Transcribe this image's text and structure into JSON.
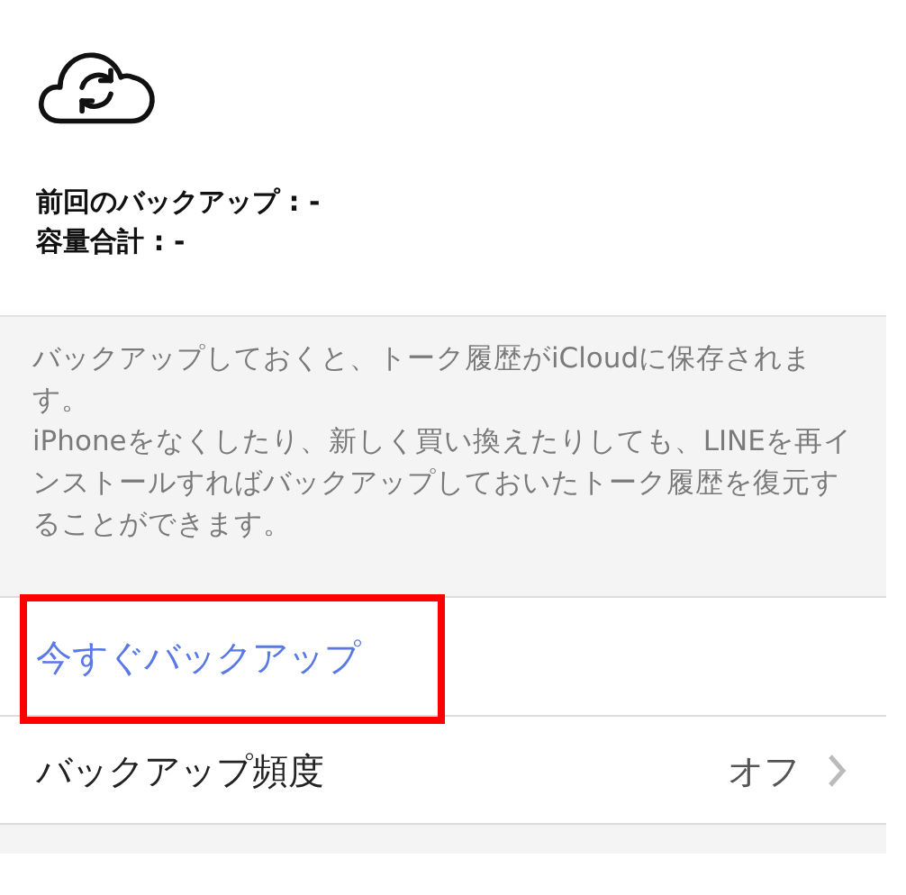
{
  "backup_info": [
    "前回のバックアップ : -",
    "容量合計 : -"
  ],
  "description": [
    "バックアップしておくと、トーク履歴がiCloudに保存されます。",
    "iPhoneをなくしたり、新しく買い換えたりしても、LINEを再インストールすればバックアップしておいたトーク履歴を復元することができます。"
  ],
  "backup_now": {
    "label": "今すぐバックアップ",
    "highlighted": true
  },
  "backup_frequency": {
    "label": "バックアップ頻度",
    "value": "オフ"
  }
}
